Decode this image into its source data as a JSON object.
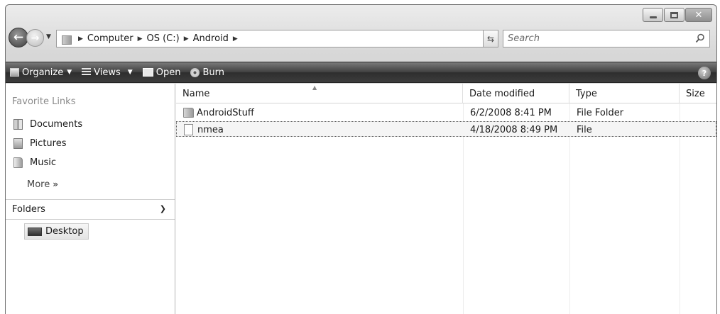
{
  "address": {
    "crumbs": [
      "Computer",
      "OS (C:)",
      "Android"
    ]
  },
  "search": {
    "placeholder": "Search"
  },
  "toolbar": {
    "organize": "Organize",
    "views": "Views",
    "open": "Open",
    "burn": "Burn",
    "help": "?"
  },
  "nav": {
    "favorites_heading": "Favorite Links",
    "links": [
      {
        "label": "Documents",
        "icon": "documents-icon"
      },
      {
        "label": "Pictures",
        "icon": "pictures-icon"
      },
      {
        "label": "Music",
        "icon": "music-icon"
      }
    ],
    "more": "More",
    "folders_heading": "Folders",
    "tree": [
      {
        "label": "Desktop",
        "icon": "desktop-icon"
      }
    ]
  },
  "file_list": {
    "columns": [
      "Name",
      "Date modified",
      "Type",
      "Size"
    ],
    "rows": [
      {
        "name": "AndroidStuff",
        "date": "6/2/2008 8:41 PM",
        "type": "File Folder",
        "size": "",
        "icon": "folder-icon",
        "selected": false
      },
      {
        "name": "nmea",
        "date": "4/18/2008 8:49 PM",
        "type": "File",
        "size": "",
        "icon": "file-icon",
        "selected": true
      }
    ]
  }
}
